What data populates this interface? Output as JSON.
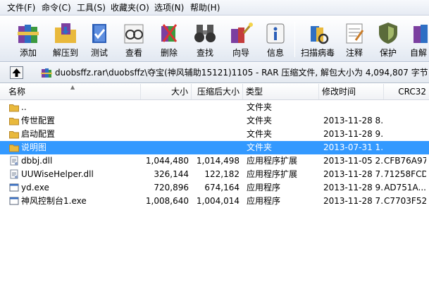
{
  "menu": [
    "文件(F)",
    "命令(C)",
    "工具(S)",
    "收藏夹(O)",
    "选项(N)",
    "帮助(H)"
  ],
  "toolbar": [
    {
      "label": "添加",
      "icon": "books-add-icon"
    },
    {
      "label": "解压到",
      "icon": "extract-folder-icon"
    },
    {
      "label": "测试",
      "icon": "test-book-icon"
    },
    {
      "label": "查看",
      "icon": "view-glasses-icon"
    },
    {
      "label": "删除",
      "icon": "delete-icon"
    },
    {
      "label": "查找",
      "icon": "binoculars-icon"
    },
    {
      "label": "向导",
      "icon": "wizard-icon"
    },
    {
      "label": "信息",
      "icon": "info-icon"
    },
    {
      "label": "扫描病毒",
      "icon": "virus-scan-icon"
    },
    {
      "label": "注释",
      "icon": "comment-icon"
    },
    {
      "label": "保护",
      "icon": "shield-icon"
    },
    {
      "label": "自解",
      "icon": "sfx-icon"
    }
  ],
  "address": {
    "path": "duobsffz.rar\\duobsffz\\夺宝(神风辅助15121)1105 - RAR 压缩文件, 解包大小为 4,094,807 字节"
  },
  "columns": [
    "名称",
    "大小",
    "压缩后大小",
    "类型",
    "修改时间",
    "CRC32"
  ],
  "files": [
    {
      "name": "..",
      "size": "",
      "packed": "",
      "type": "文件夹",
      "modified": "",
      "crc": "",
      "icon": "folder-icon"
    },
    {
      "name": "传世配置",
      "size": "",
      "packed": "",
      "type": "文件夹",
      "modified": "2013-11-28 8...",
      "crc": "",
      "icon": "folder-icon"
    },
    {
      "name": "启动配置",
      "size": "",
      "packed": "",
      "type": "文件夹",
      "modified": "2013-11-28 9...",
      "crc": "",
      "icon": "folder-icon"
    },
    {
      "name": "说明图",
      "size": "",
      "packed": "",
      "type": "文件夹",
      "modified": "2013-07-31 1...",
      "crc": "",
      "icon": "folder-icon",
      "selected": true
    },
    {
      "name": "dbbj.dll",
      "size": "1,044,480",
      "packed": "1,014,498",
      "type": "应用程序扩展",
      "modified": "2013-11-05 2...",
      "crc": "CFB76A97",
      "icon": "dll-file-icon"
    },
    {
      "name": "UUWiseHelper.dll",
      "size": "326,144",
      "packed": "122,182",
      "type": "应用程序扩展",
      "modified": "2013-11-28 7...",
      "crc": "71258FCD",
      "icon": "dll-file-icon"
    },
    {
      "name": "yd.exe",
      "size": "720,896",
      "packed": "674,164",
      "type": "应用程序",
      "modified": "2013-11-28 9...",
      "crc": "AD751A...",
      "icon": "exe-file-icon"
    },
    {
      "name": "神风控制台1.exe",
      "size": "1,008,640",
      "packed": "1,004,014",
      "type": "应用程序",
      "modified": "2013-11-28 7...",
      "crc": "C7703F52",
      "icon": "exe-file-icon"
    }
  ]
}
